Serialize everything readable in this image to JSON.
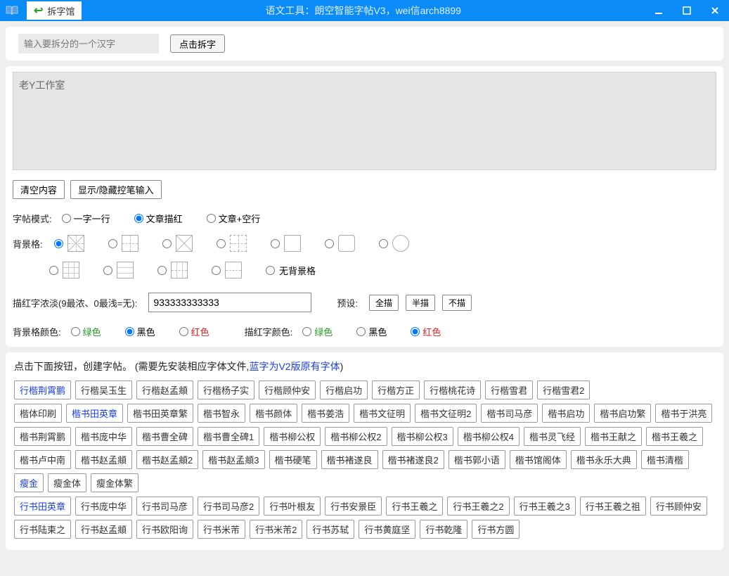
{
  "titlebar": {
    "tab_label": "拆字馆",
    "title": "语文工具：朗空智能字帖V3，wei信arch8899"
  },
  "panel1": {
    "input_placeholder": "输入要拆分的一个汉字",
    "btn": "点击拆字"
  },
  "panel2": {
    "textarea_value": "老Y工作室",
    "clear_btn": "清空内容",
    "toggle_pen_btn": "显示/隐藏控笔输入",
    "mode_label": "字帖模式:",
    "modes": [
      "一字一行",
      "文章描红",
      "文章+空行"
    ],
    "bg_label": "背景格:",
    "no_bg_label": "无背景格",
    "density_label": "描红字浓淡(9最浓、0最浅=无):",
    "density_value": "933333333333",
    "preset_label": "预设:",
    "preset_full": "全描",
    "preset_half": "半描",
    "preset_none": "不描",
    "bg_color_label": "背景格颜色:",
    "red_color_label": "描红字颜色:",
    "colors": [
      "绿色",
      "黑色",
      "红色"
    ]
  },
  "panel3": {
    "instr_a": "点击下面按钮，创建字帖。   (需要先安装相应字体文件,",
    "instr_b": "蓝字为V2版原有字体",
    "instr_c": ")",
    "group1": [
      {
        "t": "行楷荆霄鹏",
        "b": 1
      },
      {
        "t": "行楷吴玉生"
      },
      {
        "t": "行楷赵孟頫"
      },
      {
        "t": "行楷杨子实"
      },
      {
        "t": "行楷顾仲安"
      },
      {
        "t": "行楷启功"
      },
      {
        "t": "行楷方正"
      },
      {
        "t": "行楷桃花诗"
      },
      {
        "t": "行楷雪君"
      },
      {
        "t": "行楷雪君2"
      }
    ],
    "group2": [
      {
        "t": "楷体印刷"
      },
      {
        "t": "楷书田英章",
        "b": 1
      },
      {
        "t": "楷书田英章繁"
      },
      {
        "t": "楷书智永"
      },
      {
        "t": "楷书颜体"
      },
      {
        "t": "楷书姜浩"
      },
      {
        "t": "楷书文征明"
      },
      {
        "t": "楷书文征明2"
      },
      {
        "t": "楷书司马彦"
      },
      {
        "t": "楷书启功"
      },
      {
        "t": "楷书启功繁"
      },
      {
        "t": "楷书于洪亮"
      },
      {
        "t": "楷书荆霄鹏"
      },
      {
        "t": "楷书庞中华"
      },
      {
        "t": "楷书曹全碑"
      },
      {
        "t": "楷书曹全碑1"
      },
      {
        "t": "楷书柳公权"
      },
      {
        "t": "楷书柳公权2"
      },
      {
        "t": "楷书柳公权3"
      },
      {
        "t": "楷书柳公权4"
      },
      {
        "t": "楷书灵飞经"
      },
      {
        "t": "楷书王献之"
      },
      {
        "t": "楷书王羲之"
      },
      {
        "t": "楷书卢中南"
      },
      {
        "t": "楷书赵孟頫"
      },
      {
        "t": "楷书赵孟頫2"
      },
      {
        "t": "楷书赵孟頫3"
      },
      {
        "t": "楷书硬笔"
      },
      {
        "t": "楷书褚遂良"
      },
      {
        "t": "楷书褚遂良2"
      },
      {
        "t": "楷书郭小语"
      },
      {
        "t": "楷书馆阁体"
      },
      {
        "t": "楷书永乐大典"
      },
      {
        "t": "楷书清楷"
      }
    ],
    "group3": [
      {
        "t": "瘦金",
        "b": 1
      },
      {
        "t": "瘦金体"
      },
      {
        "t": "瘦金体繁"
      }
    ],
    "group4": [
      {
        "t": "行书田英章",
        "b": 1
      },
      {
        "t": "行书庞中华"
      },
      {
        "t": "行书司马彦"
      },
      {
        "t": "行书司马彦2"
      },
      {
        "t": "行书叶根友"
      },
      {
        "t": "行书安景臣"
      },
      {
        "t": "行书王羲之"
      },
      {
        "t": "行书王羲之2"
      },
      {
        "t": "行书王羲之3"
      },
      {
        "t": "行书王羲之祖"
      },
      {
        "t": "行书顾仲安"
      },
      {
        "t": "行书陆柬之"
      },
      {
        "t": "行书赵孟頫"
      },
      {
        "t": "行书欧阳询"
      },
      {
        "t": "行书米芾"
      },
      {
        "t": "行书米芾2"
      },
      {
        "t": "行书苏轼"
      },
      {
        "t": "行书黄庭坚"
      },
      {
        "t": "行书乾隆"
      },
      {
        "t": "行书方圆"
      }
    ]
  }
}
